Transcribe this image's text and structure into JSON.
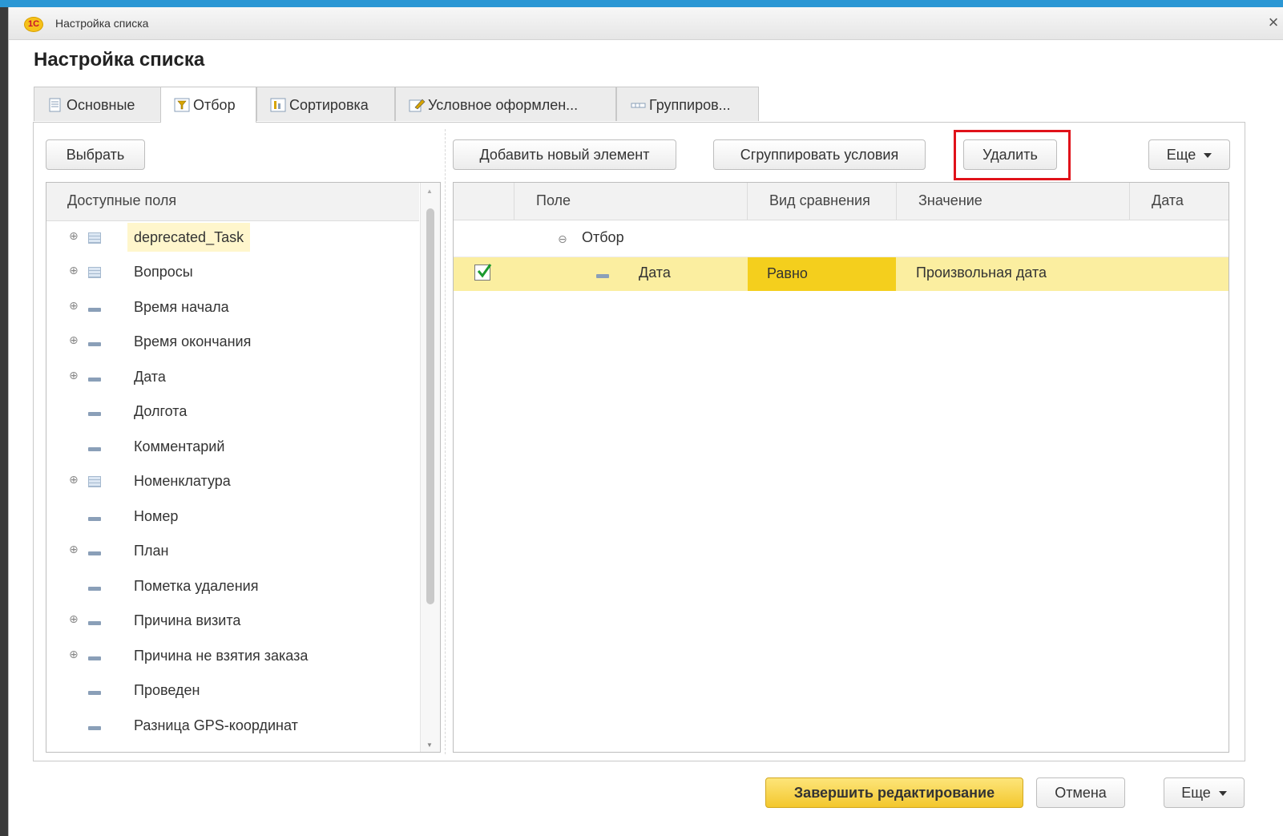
{
  "window": {
    "title": "Настройка списка",
    "heading": "Настройка списка",
    "logo_text": "1С"
  },
  "tabs": [
    {
      "label": "Основные",
      "icon": "document-icon"
    },
    {
      "label": "Отбор",
      "icon": "filter-icon",
      "active": true
    },
    {
      "label": "Сортировка",
      "icon": "sort-icon"
    },
    {
      "label": "Условное оформлен...",
      "icon": "format-icon"
    },
    {
      "label": "Группиров...",
      "icon": "grouping-icon"
    }
  ],
  "left_toolbar": {
    "select_label": "Выбрать"
  },
  "right_toolbar": {
    "add_label": "Добавить новый элемент",
    "group_label": "Сгруппировать условия",
    "delete_label": "Удалить",
    "more_label": "Еще"
  },
  "fields": {
    "header": "Доступные поля",
    "items": [
      {
        "label": "deprecated_Task",
        "expandable": true,
        "icon": "table-icon",
        "selected": true
      },
      {
        "label": "Вопросы",
        "expandable": true,
        "icon": "table-icon"
      },
      {
        "label": "Время начала",
        "expandable": true,
        "icon": "attribute-icon"
      },
      {
        "label": "Время окончания",
        "expandable": true,
        "icon": "attribute-icon"
      },
      {
        "label": "Дата",
        "expandable": true,
        "icon": "attribute-icon"
      },
      {
        "label": "Долгота",
        "expandable": false,
        "icon": "attribute-icon"
      },
      {
        "label": "Комментарий",
        "expandable": false,
        "icon": "attribute-icon"
      },
      {
        "label": "Номенклатура",
        "expandable": true,
        "icon": "table-icon"
      },
      {
        "label": "Номер",
        "expandable": false,
        "icon": "attribute-icon"
      },
      {
        "label": "План",
        "expandable": true,
        "icon": "attribute-icon"
      },
      {
        "label": "Пометка удаления",
        "expandable": false,
        "icon": "attribute-icon"
      },
      {
        "label": "Причина визита",
        "expandable": true,
        "icon": "attribute-icon"
      },
      {
        "label": "Причина не взятия заказа",
        "expandable": true,
        "icon": "attribute-icon"
      },
      {
        "label": "Проведен",
        "expandable": false,
        "icon": "attribute-icon"
      },
      {
        "label": "Разница GPS-координат",
        "expandable": false,
        "icon": "attribute-icon"
      }
    ]
  },
  "filter_table": {
    "columns": [
      "Поле",
      "Вид сравнения",
      "Значение",
      "Дата"
    ],
    "group_label": "Отбор",
    "rows": [
      {
        "checked": true,
        "field": "Дата",
        "comparison": "Равно",
        "value": "Произвольная дата",
        "date": ""
      }
    ]
  },
  "footer": {
    "finish_label": "Завершить редактирование",
    "cancel_label": "Отмена",
    "more_label": "Еще"
  },
  "colors": {
    "accent_bar": "#2b97d4",
    "primary_button": "#f3c72d",
    "selected_row": "#fbeea0",
    "highlight_border": "#e0121a"
  }
}
